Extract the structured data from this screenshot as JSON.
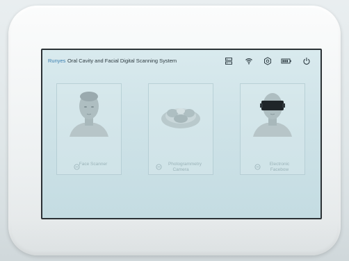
{
  "status_bar": {
    "brand": "Runyes",
    "title": "Oral Cavity and Facial Digital Scanning System",
    "icons": [
      "storage-icon",
      "wifi-icon",
      "settings-icon",
      "battery-icon",
      "power-icon"
    ]
  },
  "cards": [
    {
      "label": "Face Scanner",
      "icon": "scan-icon",
      "image": "face-head-icon"
    },
    {
      "label_line1": "Photogrammetry",
      "label_line2": "Camera",
      "icon": "scan-icon",
      "image": "dental-model-icon"
    },
    {
      "label_line1": "Electronic",
      "label_line2": "Facebow",
      "icon": "scan-icon",
      "image": "facebow-head-icon"
    }
  ],
  "colors": {
    "brand": "#3a7fb0",
    "screen_bg": "#cfe3e8",
    "bezel": "#f1f3f4"
  }
}
